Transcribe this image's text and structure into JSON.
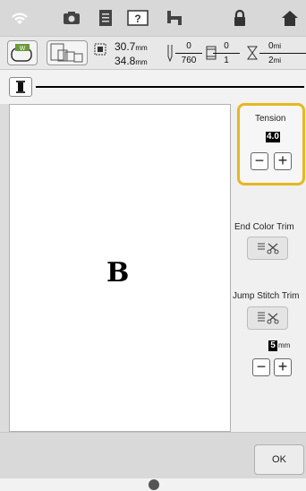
{
  "status_bar": {
    "icons": [
      "wifi-icon",
      "camera-icon",
      "document-icon",
      "help-icon",
      "needle-settings-icon",
      "lock-icon",
      "home-icon"
    ]
  },
  "info_bar": {
    "width_value": "30.7",
    "width_unit": "mm",
    "height_value": "34.8",
    "height_unit": "mm",
    "stitch_numerator": "0",
    "stitch_denominator": "760",
    "color_numerator": "0",
    "color_denominator": "1",
    "time_numerator": "0",
    "time_unit_top": "mi",
    "time_denominator": "2",
    "time_unit_bottom": "mi"
  },
  "tension": {
    "label": "Tension",
    "value": "4.0",
    "minus": "−",
    "plus": "+"
  },
  "end_color_trim": {
    "label": "End Color Trim"
  },
  "jump_stitch_trim": {
    "label": "Jump Stitch Trim",
    "value": "5",
    "unit": "mm",
    "minus": "−",
    "plus": "+"
  },
  "preview": {
    "glyph": "B"
  },
  "ok_button": {
    "label": "OK"
  },
  "colors": {
    "highlight": "#e6b820",
    "background": "#dcdcdc"
  }
}
